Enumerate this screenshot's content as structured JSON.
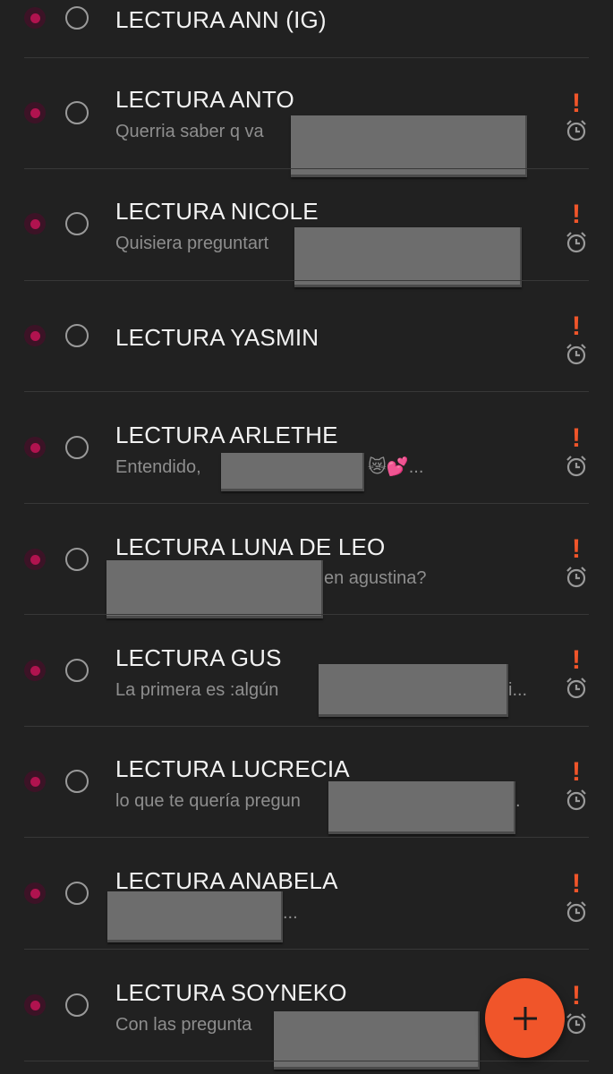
{
  "app": {
    "accent_color": "#f0552a",
    "priority_color": "#b0134f"
  },
  "tasks": [
    {
      "title": "LECTURA ANN (IG)",
      "preview_visible": "",
      "preview_suffix": "",
      "flag": "",
      "has_alarm": false
    },
    {
      "title": "LECTURA ANTO",
      "preview_visible": "Querria saber q va",
      "preview_suffix": ".",
      "flag": "!",
      "has_alarm": true
    },
    {
      "title": "LECTURA NICOLE",
      "preview_visible": "Quisiera preguntart",
      "preview_suffix": "",
      "flag": "!",
      "has_alarm": true
    },
    {
      "title": "LECTURA YASMIN",
      "preview_visible": "",
      "preview_suffix": "",
      "flag": "!",
      "has_alarm": true
    },
    {
      "title": "LECTURA ARLETHE",
      "preview_visible": "Entendido,",
      "preview_suffix": "😿💕...",
      "flag": "!",
      "has_alarm": true
    },
    {
      "title": "LECTURA LUNA DE LEO",
      "preview_visible": "",
      "preview_suffix": "en agustina?",
      "flag": "!",
      "has_alarm": true
    },
    {
      "title": "LECTURA GUS",
      "preview_visible": "La primera es :algún",
      "preview_suffix": "i...",
      "flag": "!",
      "has_alarm": true
    },
    {
      "title": "LECTURA LUCRECIA",
      "preview_visible": "lo que te quería pregun",
      "preview_suffix": ".",
      "flag": "!",
      "has_alarm": true
    },
    {
      "title": "LECTURA ANABELA",
      "preview_visible": "",
      "preview_suffix": "...",
      "flag": "!",
      "has_alarm": true
    },
    {
      "title": "LECTURA SOYNEKO",
      "preview_visible": "Con las pregunta",
      "preview_suffix": "",
      "flag": "!",
      "has_alarm": true
    }
  ],
  "fab": {
    "icon": "plus-icon"
  },
  "icons": {
    "priority": "priority-dot-icon",
    "checkbox": "checkbox-circle-icon",
    "flag": "exclamation-icon",
    "alarm": "alarm-clock-icon"
  }
}
